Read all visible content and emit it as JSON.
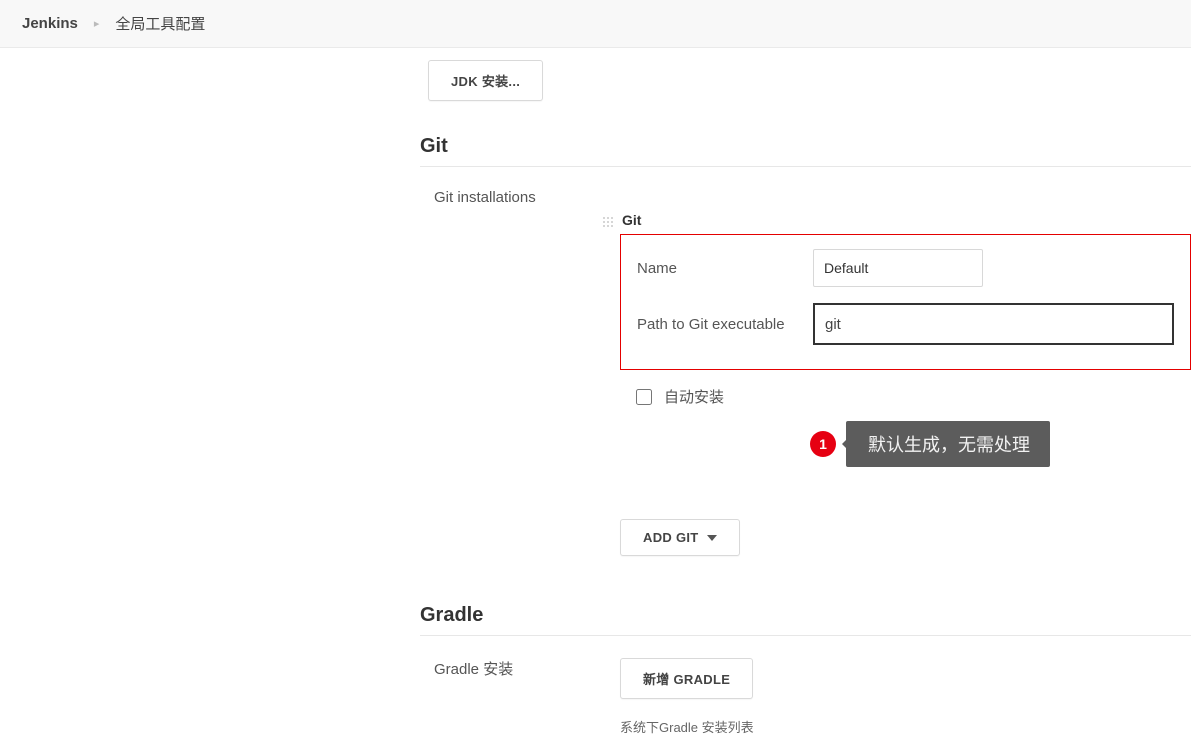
{
  "breadcrumb": {
    "home": "Jenkins",
    "current": "全局工具配置"
  },
  "jdk": {
    "button_label": "JDK 安装..."
  },
  "git": {
    "section_title": "Git",
    "installations_label": "Git installations",
    "block_title": "Git",
    "name_label": "Name",
    "name_value": "Default",
    "path_label": "Path to Git executable",
    "path_value": "git",
    "auto_install_label": "自动安装",
    "add_git_label": "ADD GIT"
  },
  "annotation": {
    "number": "1",
    "text": "默认生成，无需处理"
  },
  "gradle": {
    "section_title": "Gradle",
    "installations_label": "Gradle 安装",
    "add_button_label": "新增 GRADLE",
    "help_text": "系统下Gradle 安装列表"
  }
}
